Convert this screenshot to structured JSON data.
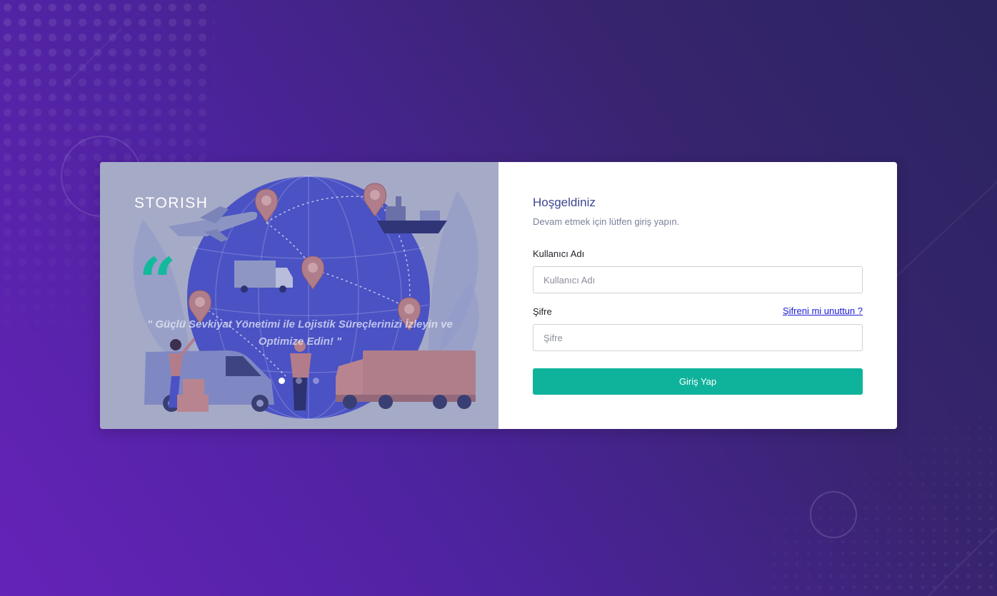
{
  "brand": {
    "name": "STORISH"
  },
  "hero": {
    "quote_icon": "quote-open-icon",
    "slogan": "\" Güçlü Sevkiyat Yönetimi ile Lojistik Süreçlerinizi İzleyin ve Optimize Edin! \"",
    "carousel": {
      "slide_count": 3,
      "active_index": 0
    }
  },
  "login": {
    "title": "Hoşgeldiniz",
    "subtitle": "Devam etmek için lütfen giriş yapın.",
    "username": {
      "label": "Kullanıcı Adı",
      "placeholder": "Kullanıcı Adı",
      "value": ""
    },
    "password": {
      "label": "Şifre",
      "placeholder": "Şifre",
      "value": ""
    },
    "forgot_link": "Şifreni mi unuttun ?",
    "submit_label": "Giriş Yap"
  },
  "colors": {
    "accent": "#0fb39b",
    "title": "#3d4690",
    "link": "#1a1ad6",
    "background_start": "#6523b8",
    "background_end": "#2b2460"
  }
}
